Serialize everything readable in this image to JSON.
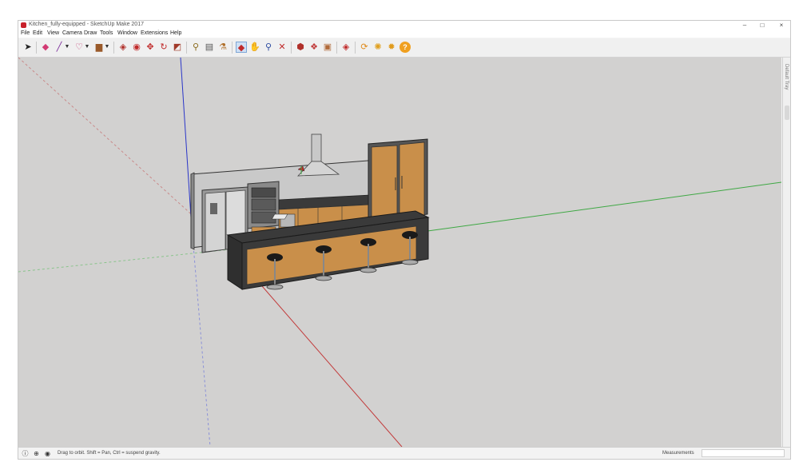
{
  "window": {
    "title": "Kitchen_fully-equipped - SketchUp Make 2017",
    "minimize": "–",
    "maximize": "□",
    "close": "×"
  },
  "menu": [
    "File",
    "Edit",
    "View",
    "Camera",
    "Draw",
    "Tools",
    "Window",
    "Extensions",
    "Help"
  ],
  "toolbar_icons": [
    "select-arrow-icon",
    "eraser-icon",
    "pencil-line-icon",
    "dropdown-arrow-icon",
    "freehand-icon",
    "dropdown-arrow-icon",
    "rectangle-icon",
    "dropdown-arrow-icon",
    "push-pull-icon",
    "offset-icon",
    "move-icon",
    "rotate-icon",
    "scale-icon",
    "tape-measure-icon",
    "text-icon",
    "paint-bucket-icon",
    "orbit-icon",
    "pan-icon",
    "zoom-icon",
    "zoom-extents-icon",
    "warehouse-icon",
    "components-icon",
    "materials-icon",
    "extension-warehouse-icon",
    "ruby-red-icon",
    "refresh-icon",
    "sun-icon",
    "gear-icon",
    "info-icon"
  ],
  "side_tab": {
    "label": "Default Tray"
  },
  "status": {
    "hint": "Drag to orbit. Shift = Pan, Ctrl = suspend gravity.",
    "measurements_label": "Measurements",
    "measurements_value": ""
  },
  "colors": {
    "viewport_bg": "#d2d1d0",
    "axis_red": "#c23a3a",
    "axis_green": "#3fa844",
    "axis_blue": "#2a35c8",
    "wood": "#c98f4a",
    "countertop": "#3a3a3a",
    "steel": "#c8c8c8"
  }
}
